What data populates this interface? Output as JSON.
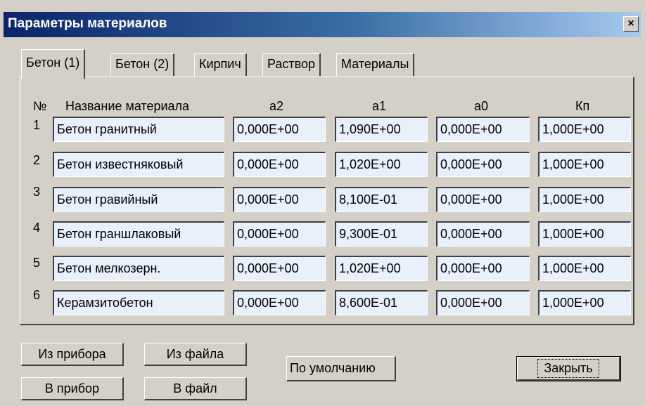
{
  "window": {
    "title": "Параметры материалов",
    "close_symbol": "×"
  },
  "tabs": [
    {
      "label": "Бетон (1)",
      "active": true
    },
    {
      "label": "Бетон (2)",
      "active": false
    },
    {
      "label": "Кирпич",
      "active": false
    },
    {
      "label": "Раствор",
      "active": false
    },
    {
      "label": "Материалы",
      "active": false
    }
  ],
  "table": {
    "headers": {
      "num": "№",
      "name": "Название материала",
      "a2": "а2",
      "a1": "а1",
      "a0": "а0",
      "kp": "Кп"
    },
    "rows": [
      {
        "num": "1",
        "name": "Бетон гранитный",
        "a2": "0,000E+00",
        "a1": "1,090E+00",
        "a0": "0,000E+00",
        "kp": "1,000E+00"
      },
      {
        "num": "2",
        "name": "Бетон известняковый",
        "a2": "0,000E+00",
        "a1": "1,020E+00",
        "a0": "0,000E+00",
        "kp": "1,000E+00"
      },
      {
        "num": "3",
        "name": "Бетон гравийный",
        "a2": "0,000E+00",
        "a1": "8,100E-01",
        "a0": "0,000E+00",
        "kp": "1,000E+00"
      },
      {
        "num": "4",
        "name": "Бетон граншлаковый",
        "a2": "0,000E+00",
        "a1": "9,300E-01",
        "a0": "0,000E+00",
        "kp": "1,000E+00"
      },
      {
        "num": "5",
        "name": "Бетон мелкозерн.",
        "a2": "0,000E+00",
        "a1": "1,020E+00",
        "a0": "0,000E+00",
        "kp": "1,000E+00"
      },
      {
        "num": "6",
        "name": "Керамзитобетон",
        "a2": "0,000E+00",
        "a1": "8,600E-01",
        "a0": "0,000E+00",
        "kp": "1,000E+00"
      }
    ]
  },
  "buttons": {
    "from_device": "Из прибора",
    "from_file": "Из файла",
    "to_device": "В прибор",
    "to_file": "В файл",
    "defaults": "По умолчанию",
    "close": "Закрыть"
  }
}
